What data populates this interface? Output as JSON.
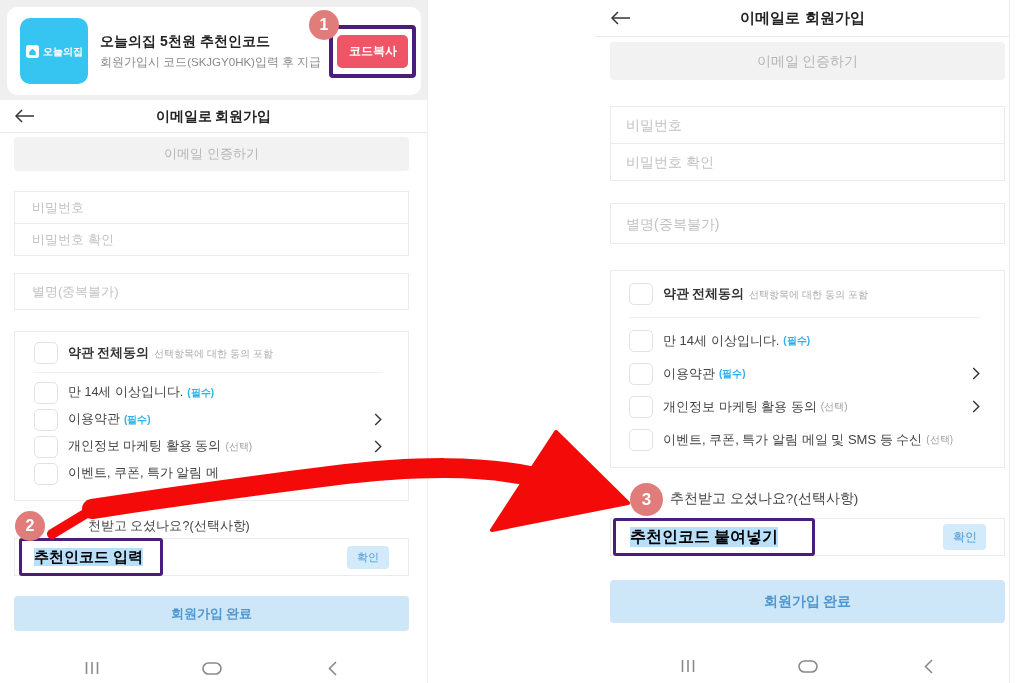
{
  "screens": [
    {
      "banner": {
        "logo_text": "오늘의집",
        "title": "오늘의집 5천원 추천인코드",
        "subtitle": "회원가입시 코드(SKJGY0HK)입력 후 지급",
        "copy_button": {
          "label": "코드복사",
          "callout": true
        },
        "step": "1"
      },
      "header": {
        "title": "이메일로 회원가입"
      },
      "verify_button": "이메일 인증하기",
      "password_fields": [
        {
          "placeholder": "비밀번호"
        },
        {
          "placeholder": "비밀번호 확인"
        }
      ],
      "nickname_field": {
        "placeholder": "별명(중복불가)"
      },
      "terms": {
        "all": {
          "label": "약관 전체동의",
          "note": "선택항목에 대한 동의 포함",
          "checked": false
        },
        "items": [
          {
            "label": "만 14세 이상입니다.",
            "tag": {
              "text": "(필수)",
              "kind": "required"
            },
            "checked": false,
            "arrow": false
          },
          {
            "label": "이용약관",
            "tag": {
              "text": "(필수)",
              "kind": "required"
            },
            "checked": false,
            "arrow": true
          },
          {
            "label": "개인정보 마케팅 활용 동의",
            "tag": {
              "text": "(선택)",
              "kind": "optional"
            },
            "checked": false,
            "arrow": true
          },
          {
            "label": "이벤트, 쿠폰, 특가 알림 메",
            "checked": false,
            "arrow": false
          }
        ]
      },
      "referral": {
        "step": "2",
        "label": "천받고 오셨나요?(선택사항)",
        "value": "추천인코드 입력",
        "highlighted": true,
        "callout": true,
        "confirm_button": "확인"
      },
      "submit_button": "회원가입 완료"
    },
    {
      "header": {
        "title": "이메일로 회원가입"
      },
      "verify_button": "이메일 인증하기",
      "password_fields": [
        {
          "placeholder": "비밀번호"
        },
        {
          "placeholder": "비밀번호 확인"
        }
      ],
      "nickname_field": {
        "placeholder": "별명(중복불가)"
      },
      "terms": {
        "all": {
          "label": "약관 전체동의",
          "note": "선택항목에 대한 동의 포함",
          "checked": false
        },
        "items": [
          {
            "label": "만 14세 이상입니다.",
            "tag": {
              "text": "(필수)",
              "kind": "required"
            },
            "checked": false,
            "arrow": false
          },
          {
            "label": "이용약관",
            "tag": {
              "text": "(필수)",
              "kind": "required"
            },
            "checked": false,
            "arrow": true
          },
          {
            "label": "개인정보 마케팅 활용 동의",
            "tag": {
              "text": "(선택)",
              "kind": "optional"
            },
            "checked": false,
            "arrow": true
          },
          {
            "label": "이벤트, 쿠폰, 특가 알림 메일 및 SMS 등 수신",
            "tag": {
              "text": "(선택)",
              "kind": "optional"
            },
            "checked": false,
            "arrow": false
          }
        ]
      },
      "referral": {
        "step": "3",
        "label": "추천받고 오셨나요?(선택사항)",
        "value": "추천인코드 붙여넣기",
        "highlighted": true,
        "callout": true,
        "confirm_button": "확인"
      },
      "submit_button": "회원가입 완료"
    }
  ]
}
